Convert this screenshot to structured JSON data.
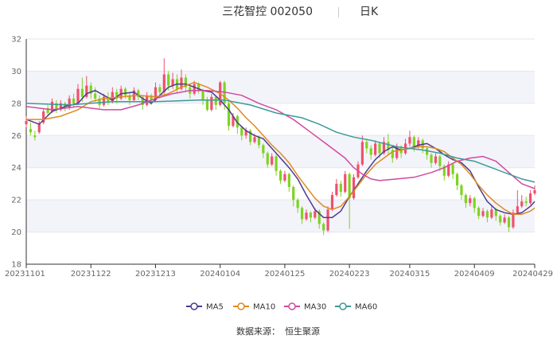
{
  "header": {
    "title": "三花智控 002050",
    "period": "日K"
  },
  "source": {
    "label": "数据来源：",
    "value": "恒生聚源"
  },
  "chart_data": {
    "type": "line",
    "subtype": "candlestick-with-moving-averages",
    "ylim": [
      18,
      32
    ],
    "yticks": [
      18,
      20,
      22,
      24,
      26,
      28,
      30,
      32
    ],
    "x_range": [
      0,
      118
    ],
    "xticks": [
      {
        "i": 0,
        "label": "20231101"
      },
      {
        "i": 15,
        "label": "20231122"
      },
      {
        "i": 30,
        "label": "20231213"
      },
      {
        "i": 45,
        "label": "20240104"
      },
      {
        "i": 60,
        "label": "20240125"
      },
      {
        "i": 75,
        "label": "20240223"
      },
      {
        "i": 89,
        "label": "20240315"
      },
      {
        "i": 104,
        "label": "20240409"
      },
      {
        "i": 118,
        "label": "20240429"
      }
    ],
    "grid": true,
    "legend_position": "bottom",
    "colors": {
      "up": "#f0506e",
      "down": "#7ed321",
      "grid": "#e6e6ee",
      "band": "#f3f3fa",
      "axis": "#333333"
    },
    "series": [
      {
        "name": "MA5",
        "color": "#4b3c8c",
        "points": [
          [
            0,
            27.0
          ],
          [
            3,
            26.7
          ],
          [
            6,
            27.5
          ],
          [
            9,
            27.8
          ],
          [
            12,
            28.0
          ],
          [
            14,
            28.6
          ],
          [
            16,
            28.8
          ],
          [
            18,
            28.5
          ],
          [
            20,
            28.2
          ],
          [
            22,
            28.6
          ],
          [
            25,
            28.7
          ],
          [
            27,
            28.3
          ],
          [
            29,
            28.0
          ],
          [
            31,
            28.5
          ],
          [
            33,
            29.0
          ],
          [
            35,
            29.2
          ],
          [
            37,
            29.2
          ],
          [
            39,
            29.0
          ],
          [
            41,
            28.8
          ],
          [
            43,
            28.7
          ],
          [
            45,
            28.2
          ],
          [
            47,
            27.6
          ],
          [
            49,
            26.8
          ],
          [
            51,
            26.3
          ],
          [
            53,
            26.0
          ],
          [
            55,
            25.8
          ],
          [
            57,
            25.2
          ],
          [
            59,
            24.6
          ],
          [
            61,
            24.0
          ],
          [
            63,
            23.3
          ],
          [
            65,
            22.3
          ],
          [
            67,
            21.4
          ],
          [
            69,
            20.9
          ],
          [
            71,
            20.9
          ],
          [
            73,
            21.3
          ],
          [
            75,
            22.2
          ],
          [
            77,
            23.0
          ],
          [
            79,
            23.8
          ],
          [
            81,
            24.5
          ],
          [
            83,
            25.0
          ],
          [
            85,
            25.3
          ],
          [
            87,
            25.1
          ],
          [
            89,
            25.2
          ],
          [
            91,
            25.4
          ],
          [
            93,
            25.5
          ],
          [
            95,
            25.2
          ],
          [
            97,
            24.8
          ],
          [
            99,
            24.5
          ],
          [
            101,
            24.3
          ],
          [
            103,
            23.8
          ],
          [
            105,
            22.8
          ],
          [
            107,
            21.9
          ],
          [
            109,
            21.4
          ],
          [
            111,
            21.2
          ],
          [
            113,
            21.1
          ],
          [
            115,
            21.2
          ],
          [
            117,
            21.6
          ],
          [
            118,
            21.9
          ]
        ]
      },
      {
        "name": "MA10",
        "color": "#e08a1e",
        "points": [
          [
            0,
            27.0
          ],
          [
            4,
            27.0
          ],
          [
            8,
            27.2
          ],
          [
            12,
            27.6
          ],
          [
            15,
            28.1
          ],
          [
            18,
            28.3
          ],
          [
            22,
            28.4
          ],
          [
            26,
            28.5
          ],
          [
            30,
            28.4
          ],
          [
            33,
            28.6
          ],
          [
            36,
            29.0
          ],
          [
            39,
            29.3
          ],
          [
            42,
            29.0
          ],
          [
            45,
            28.6
          ],
          [
            47,
            28.2
          ],
          [
            49,
            27.7
          ],
          [
            51,
            27.1
          ],
          [
            53,
            26.6
          ],
          [
            55,
            26.0
          ],
          [
            57,
            25.4
          ],
          [
            59,
            24.9
          ],
          [
            61,
            24.3
          ],
          [
            63,
            23.5
          ],
          [
            65,
            22.8
          ],
          [
            67,
            22.1
          ],
          [
            69,
            21.6
          ],
          [
            71,
            21.4
          ],
          [
            73,
            21.6
          ],
          [
            75,
            22.2
          ],
          [
            77,
            22.9
          ],
          [
            79,
            23.6
          ],
          [
            81,
            24.2
          ],
          [
            83,
            24.6
          ],
          [
            85,
            25.0
          ],
          [
            87,
            25.1
          ],
          [
            89,
            25.2
          ],
          [
            91,
            25.3
          ],
          [
            93,
            25.3
          ],
          [
            95,
            25.2
          ],
          [
            97,
            25.0
          ],
          [
            99,
            24.6
          ],
          [
            101,
            24.2
          ],
          [
            103,
            23.6
          ],
          [
            105,
            22.9
          ],
          [
            107,
            22.3
          ],
          [
            109,
            21.8
          ],
          [
            111,
            21.4
          ],
          [
            113,
            21.1
          ],
          [
            115,
            21.1
          ],
          [
            117,
            21.3
          ],
          [
            118,
            21.5
          ]
        ]
      },
      {
        "name": "MA30",
        "color": "#d04aa0",
        "points": [
          [
            0,
            27.8
          ],
          [
            6,
            27.6
          ],
          [
            12,
            27.8
          ],
          [
            18,
            27.6
          ],
          [
            22,
            27.6
          ],
          [
            26,
            27.9
          ],
          [
            30,
            28.3
          ],
          [
            34,
            28.6
          ],
          [
            38,
            28.8
          ],
          [
            42,
            28.8
          ],
          [
            46,
            28.7
          ],
          [
            50,
            28.5
          ],
          [
            54,
            28.0
          ],
          [
            58,
            27.6
          ],
          [
            62,
            27.0
          ],
          [
            66,
            26.2
          ],
          [
            70,
            25.4
          ],
          [
            74,
            24.6
          ],
          [
            76,
            24.0
          ],
          [
            78,
            23.6
          ],
          [
            80,
            23.3
          ],
          [
            82,
            23.2
          ],
          [
            86,
            23.3
          ],
          [
            90,
            23.4
          ],
          [
            94,
            23.7
          ],
          [
            97,
            24.0
          ],
          [
            100,
            24.4
          ],
          [
            103,
            24.6
          ],
          [
            106,
            24.7
          ],
          [
            109,
            24.4
          ],
          [
            112,
            23.7
          ],
          [
            115,
            23.0
          ],
          [
            118,
            22.7
          ]
        ]
      },
      {
        "name": "MA60",
        "color": "#3c9a98",
        "points": [
          [
            0,
            28.0
          ],
          [
            10,
            27.9
          ],
          [
            20,
            28.1
          ],
          [
            30,
            28.1
          ],
          [
            40,
            28.2
          ],
          [
            46,
            28.2
          ],
          [
            52,
            27.9
          ],
          [
            58,
            27.4
          ],
          [
            64,
            27.1
          ],
          [
            68,
            26.7
          ],
          [
            72,
            26.2
          ],
          [
            76,
            25.9
          ],
          [
            80,
            25.7
          ],
          [
            86,
            25.3
          ],
          [
            92,
            25.1
          ],
          [
            96,
            24.9
          ],
          [
            100,
            24.6
          ],
          [
            104,
            24.4
          ],
          [
            108,
            24.0
          ],
          [
            112,
            23.6
          ],
          [
            115,
            23.3
          ],
          [
            118,
            23.1
          ]
        ]
      }
    ],
    "candles": [
      [
        26.7,
        26.9,
        26.5,
        27.2
      ],
      [
        26.4,
        26.2,
        26.0,
        26.8
      ],
      [
        26.0,
        25.9,
        25.7,
        26.3
      ],
      [
        26.2,
        26.7,
        26.1,
        26.9
      ],
      [
        26.8,
        27.5,
        26.7,
        27.7
      ],
      [
        27.7,
        27.4,
        27.2,
        27.9
      ],
      [
        27.5,
        28.1,
        27.4,
        28.3
      ],
      [
        28.0,
        27.6,
        27.4,
        28.2
      ],
      [
        27.6,
        28.0,
        27.5,
        28.2
      ],
      [
        28.0,
        27.7,
        27.5,
        28.1
      ],
      [
        27.7,
        28.3,
        27.6,
        28.5
      ],
      [
        28.3,
        28.0,
        27.8,
        28.6
      ],
      [
        28.0,
        28.9,
        27.9,
        29.2
      ],
      [
        28.9,
        28.4,
        28.1,
        29.6
      ],
      [
        28.4,
        29.1,
        28.3,
        29.7
      ],
      [
        29.1,
        28.6,
        28.3,
        29.3
      ],
      [
        28.6,
        28.3,
        28.1,
        29.0
      ],
      [
        28.3,
        27.9,
        27.7,
        28.5
      ],
      [
        27.9,
        28.4,
        27.8,
        28.6
      ],
      [
        28.4,
        28.1,
        27.9,
        28.7
      ],
      [
        28.1,
        28.7,
        28.0,
        29.0
      ],
      [
        28.7,
        28.3,
        28.0,
        28.9
      ],
      [
        28.3,
        28.9,
        28.2,
        29.1
      ],
      [
        28.9,
        28.5,
        28.3,
        29.0
      ],
      [
        28.5,
        28.2,
        27.9,
        28.7
      ],
      [
        28.2,
        28.8,
        28.1,
        29.0
      ],
      [
        28.8,
        28.4,
        28.2,
        28.9
      ],
      [
        28.4,
        27.9,
        27.6,
        28.5
      ],
      [
        27.9,
        28.5,
        27.8,
        28.7
      ],
      [
        28.5,
        28.2,
        27.9,
        28.6
      ],
      [
        28.2,
        29.0,
        28.1,
        29.3
      ],
      [
        29.0,
        28.7,
        28.3,
        29.2
      ],
      [
        28.7,
        29.8,
        28.6,
        30.8
      ],
      [
        29.8,
        29.1,
        28.8,
        30.0
      ],
      [
        29.1,
        29.5,
        28.9,
        29.9
      ],
      [
        29.5,
        28.9,
        28.6,
        29.8
      ],
      [
        28.9,
        29.6,
        28.8,
        30.1
      ],
      [
        29.6,
        29.0,
        28.7,
        29.8
      ],
      [
        29.0,
        28.6,
        28.3,
        29.2
      ],
      [
        28.6,
        29.2,
        28.5,
        29.4
      ],
      [
        29.2,
        28.8,
        28.6,
        29.3
      ],
      [
        28.8,
        28.2,
        27.9,
        28.9
      ],
      [
        28.2,
        27.6,
        27.5,
        28.4
      ],
      [
        27.6,
        28.4,
        27.5,
        28.6
      ],
      [
        28.4,
        27.9,
        27.6,
        28.5
      ],
      [
        27.9,
        29.3,
        27.8,
        29.4
      ],
      [
        29.3,
        28.0,
        27.6,
        29.4
      ],
      [
        28.0,
        26.6,
        26.3,
        28.1
      ],
      [
        26.6,
        27.2,
        26.5,
        27.4
      ],
      [
        27.2,
        26.5,
        26.1,
        27.3
      ],
      [
        26.5,
        26.0,
        25.7,
        26.6
      ],
      [
        26.0,
        26.3,
        25.8,
        26.5
      ],
      [
        26.3,
        25.6,
        25.4,
        26.4
      ],
      [
        25.6,
        25.9,
        25.5,
        26.1
      ],
      [
        25.9,
        25.4,
        25.2,
        26.0
      ],
      [
        25.4,
        24.9,
        24.6,
        25.5
      ],
      [
        24.9,
        24.2,
        24.0,
        25.0
      ],
      [
        24.2,
        24.7,
        24.1,
        24.9
      ],
      [
        24.7,
        23.8,
        23.5,
        24.8
      ],
      [
        23.8,
        23.2,
        23.0,
        23.9
      ],
      [
        23.2,
        23.6,
        23.1,
        23.8
      ],
      [
        23.6,
        22.8,
        22.5,
        23.7
      ],
      [
        22.8,
        22.0,
        21.6,
        22.9
      ],
      [
        22.0,
        21.5,
        21.2,
        22.1
      ],
      [
        21.5,
        20.8,
        20.5,
        21.6
      ],
      [
        20.8,
        21.2,
        20.7,
        21.4
      ],
      [
        21.2,
        20.9,
        20.6,
        21.3
      ],
      [
        20.9,
        21.3,
        20.8,
        21.5
      ],
      [
        21.3,
        20.5,
        20.2,
        21.4
      ],
      [
        20.5,
        20.1,
        19.8,
        20.6
      ],
      [
        20.1,
        21.4,
        20.0,
        21.6
      ],
      [
        21.4,
        22.3,
        21.3,
        22.5
      ],
      [
        22.3,
        23.0,
        22.2,
        23.3
      ],
      [
        23.0,
        22.5,
        22.2,
        23.2
      ],
      [
        22.5,
        23.6,
        22.4,
        23.8
      ],
      [
        23.6,
        22.1,
        20.2,
        23.7
      ],
      [
        22.1,
        23.4,
        22.0,
        23.6
      ],
      [
        23.4,
        24.2,
        23.3,
        24.4
      ],
      [
        24.2,
        25.6,
        24.1,
        26.0
      ],
      [
        25.6,
        25.2,
        24.9,
        25.8
      ],
      [
        25.2,
        24.8,
        24.5,
        25.4
      ],
      [
        24.8,
        25.5,
        24.7,
        25.7
      ],
      [
        25.5,
        24.9,
        24.6,
        25.6
      ],
      [
        24.9,
        25.6,
        24.8,
        25.9
      ],
      [
        25.6,
        25.1,
        24.8,
        26.1
      ],
      [
        25.1,
        24.6,
        24.3,
        25.3
      ],
      [
        24.6,
        25.3,
        24.5,
        25.5
      ],
      [
        25.3,
        24.9,
        24.6,
        25.4
      ],
      [
        24.9,
        25.5,
        24.8,
        25.8
      ],
      [
        25.5,
        25.9,
        25.3,
        26.3
      ],
      [
        25.9,
        25.3,
        25.0,
        26.0
      ],
      [
        25.3,
        25.7,
        25.2,
        25.9
      ],
      [
        25.7,
        25.2,
        24.9,
        25.8
      ],
      [
        25.2,
        24.8,
        24.5,
        25.3
      ],
      [
        24.8,
        24.3,
        24.0,
        24.9
      ],
      [
        24.3,
        24.7,
        24.2,
        24.9
      ],
      [
        24.7,
        24.1,
        23.8,
        24.8
      ],
      [
        24.1,
        23.5,
        23.2,
        24.2
      ],
      [
        23.5,
        24.2,
        23.4,
        24.4
      ],
      [
        24.2,
        23.6,
        23.3,
        24.3
      ],
      [
        23.6,
        22.9,
        22.6,
        23.7
      ],
      [
        22.9,
        22.3,
        22.0,
        23.0
      ],
      [
        22.3,
        21.8,
        21.5,
        22.4
      ],
      [
        21.8,
        22.1,
        21.6,
        22.3
      ],
      [
        22.1,
        21.5,
        21.2,
        22.2
      ],
      [
        21.5,
        21.0,
        20.8,
        21.6
      ],
      [
        21.0,
        21.3,
        20.9,
        21.5
      ],
      [
        21.3,
        20.9,
        20.6,
        21.4
      ],
      [
        20.9,
        21.4,
        20.8,
        21.7
      ],
      [
        21.4,
        21.0,
        20.7,
        21.5
      ],
      [
        21.0,
        20.6,
        20.4,
        21.1
      ],
      [
        20.6,
        20.9,
        20.5,
        21.1
      ],
      [
        20.9,
        20.3,
        20.0,
        21.0
      ],
      [
        20.3,
        21.2,
        20.2,
        21.4
      ],
      [
        21.2,
        21.6,
        21.1,
        22.6
      ],
      [
        21.6,
        21.9,
        21.5,
        22.3
      ],
      [
        21.9,
        21.8,
        21.6,
        22.2
      ],
      [
        21.8,
        22.4,
        21.7,
        22.6
      ],
      [
        22.4,
        22.6,
        22.3,
        22.9
      ]
    ]
  }
}
